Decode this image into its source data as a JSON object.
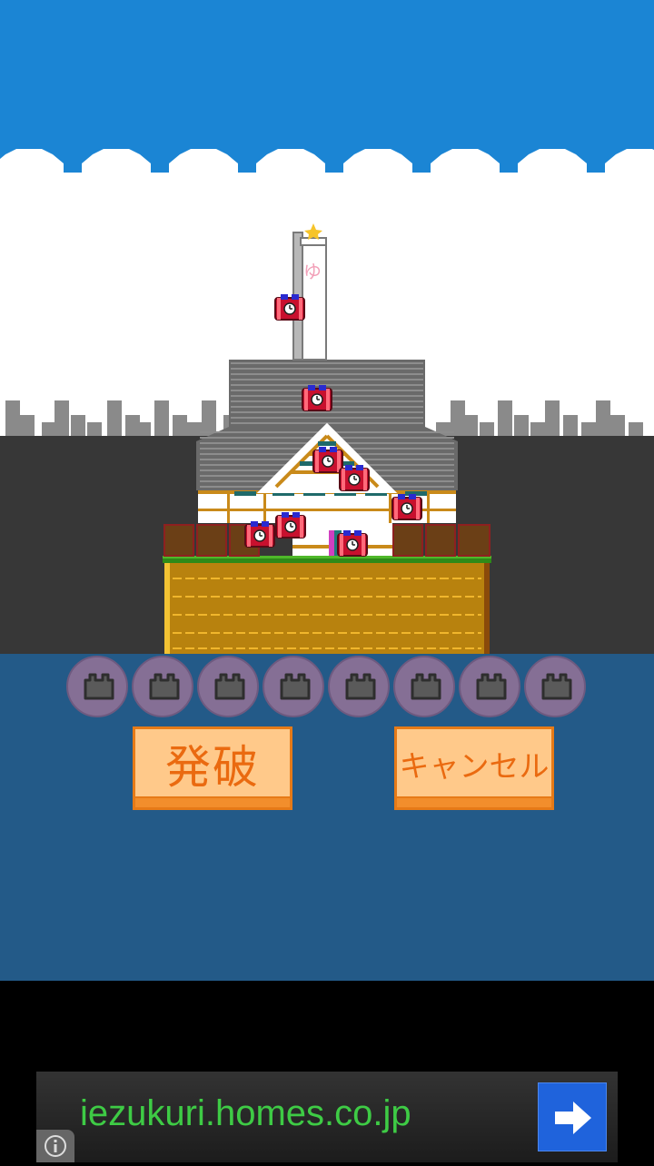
{
  "game": {
    "sky_color": "#1b85d4",
    "ground_color": "#373737",
    "water_color": "#235a88",
    "banner_char": "ゆ",
    "bomb_count_placed": 9,
    "slot_count": 8,
    "slot_icon": "empty-bomb-slot-icon"
  },
  "buttons": {
    "detonate_label": "発破",
    "cancel_label": "キャンセル",
    "accent_color": "#ea6a10"
  },
  "ad": {
    "url_text": "iezukuri.homes.co.jp",
    "arrow_icon": "arrow-right-icon",
    "info_icon": "info-icon"
  }
}
